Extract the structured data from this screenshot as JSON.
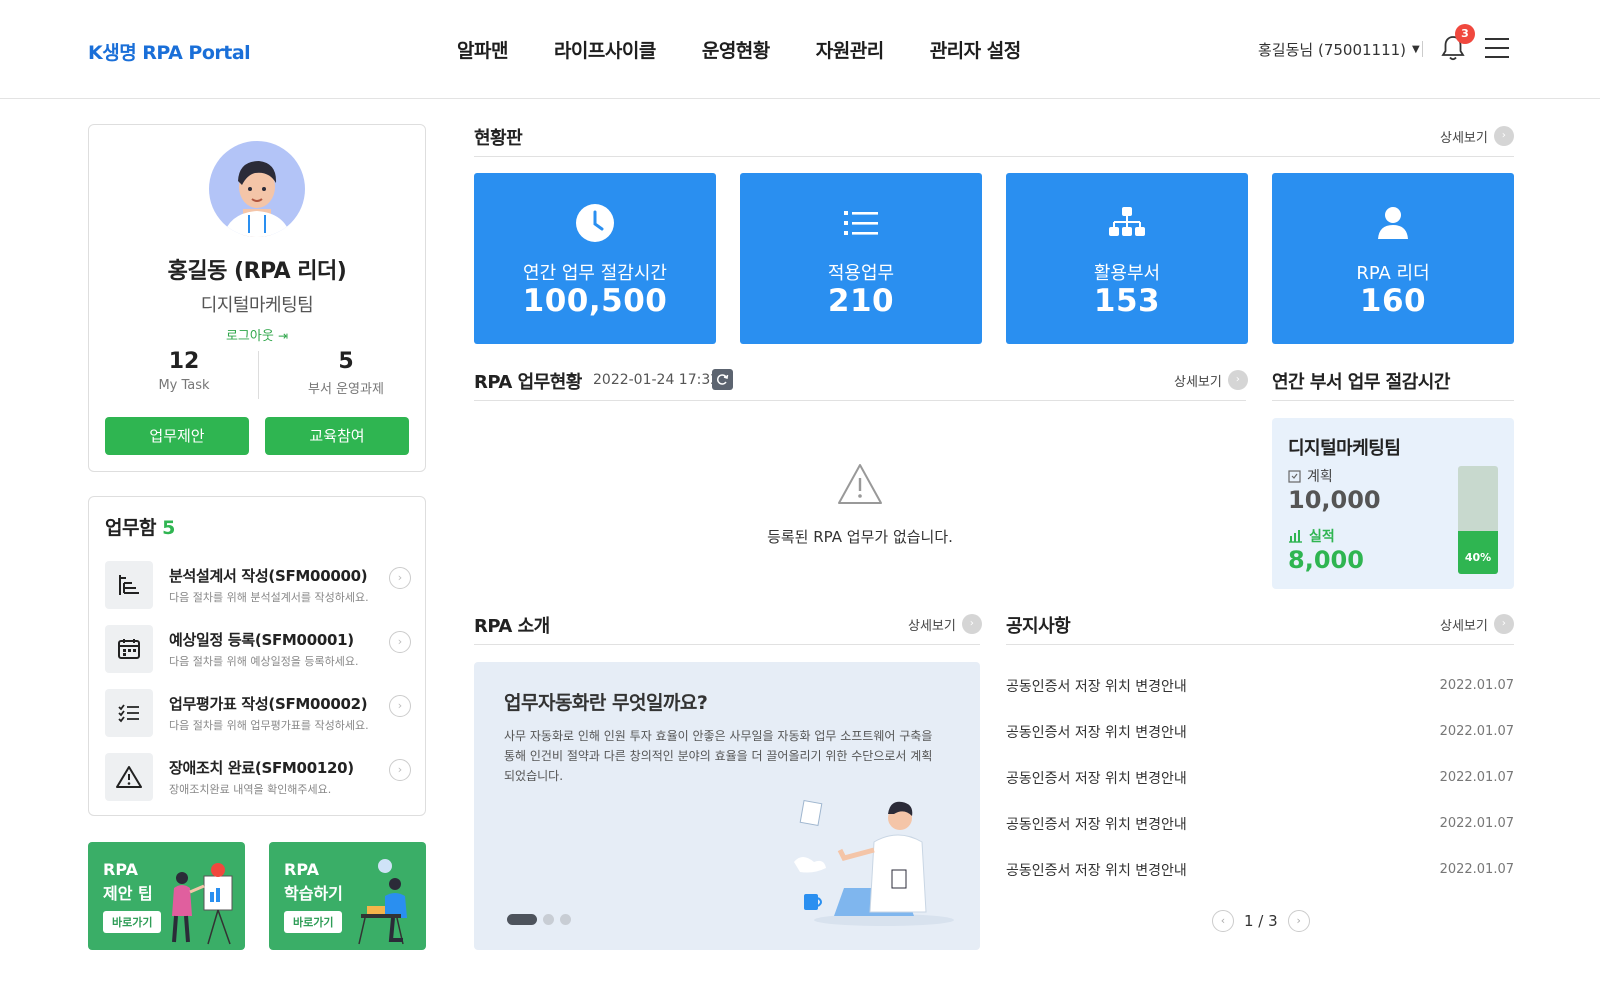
{
  "header": {
    "logo": "K생명 RPA Portal",
    "nav": [
      "알파맨",
      "라이프사이클",
      "운영현황",
      "자원관리",
      "관리자 설정"
    ],
    "user": "홍길동님 (75001111)",
    "notification_count": "3"
  },
  "profile": {
    "name": "홍길동 (RPA 리더)",
    "team": "디지털마케팅팀",
    "logout": "로그아웃",
    "stats": [
      {
        "value": "12",
        "label": "My Task"
      },
      {
        "value": "5",
        "label": "부서 운영과제"
      }
    ],
    "buttons": [
      "업무제안",
      "교육참여"
    ]
  },
  "tasks": {
    "title": "업무함",
    "count": "5",
    "items": [
      {
        "icon": "flowchart-icon",
        "name": "분석설계서 작성(SFM00000)",
        "desc": "다음 절차를 위해 분석설계서를 작성하세요."
      },
      {
        "icon": "calendar-icon",
        "name": "예상일정 등록(SFM00001)",
        "desc": "다음 절차를 위해 예상일정을 등록하세요."
      },
      {
        "icon": "checklist-icon",
        "name": "업무평가표 작성(SFM00002)",
        "desc": "다음 절차를 위해 업무평가표를 작성하세요."
      },
      {
        "icon": "warning-icon",
        "name": "장애조치 완료(SFM00120)",
        "desc": "장애조치완료 내역을 확인해주세요."
      }
    ]
  },
  "banners": [
    {
      "line1": "RPA",
      "line2": "제안 팁",
      "go": "바로가기"
    },
    {
      "line1": "RPA",
      "line2": "학습하기",
      "go": "바로가기"
    }
  ],
  "dashboard": {
    "title": "현황판",
    "more": "상세보기",
    "tiles": [
      {
        "icon": "clock-icon",
        "label": "연간 업무 절감시간",
        "value": "100,500"
      },
      {
        "icon": "list-icon",
        "label": "적용업무",
        "value": "210"
      },
      {
        "icon": "org-chart-icon",
        "label": "활용부서",
        "value": "153"
      },
      {
        "icon": "user-icon",
        "label": "RPA 리더",
        "value": "160"
      }
    ]
  },
  "rpa_status": {
    "title": "RPA 업무현황",
    "timestamp": "2022-01-24 17:32",
    "more": "상세보기",
    "empty": "등록된 RPA 업무가 없습니다."
  },
  "dept_saving": {
    "title": "연간 부서 업무 절감시간",
    "dept": "디지털마케팅팀",
    "plan_label": "계획",
    "plan_value": "10,000",
    "actual_label": "실적",
    "actual_value": "8,000",
    "percent_label": "40%",
    "percent": 0.4
  },
  "intro": {
    "title": "RPA 소개",
    "more": "상세보기",
    "heading": "업무자동화란 무엇일까요?",
    "body": "사무 자동화로 인해 인원 투자 효율이 안좋은 사무일을 자동화 업무 소프트웨어 구축을 통해 인건비 절약과 다른 창의적인 분야의 효율을 더 끌어올리기 위한 수단으로서 계획되었습니다."
  },
  "notice": {
    "title": "공지사항",
    "more": "상세보기",
    "items": [
      {
        "title": "공동인증서 저장 위치 변경안내",
        "date": "2022.01.07"
      },
      {
        "title": "공동인증서 저장 위치 변경안내",
        "date": "2022.01.07"
      },
      {
        "title": "공동인증서 저장 위치 변경안내",
        "date": "2022.01.07"
      },
      {
        "title": "공동인증서 저장 위치 변경안내",
        "date": "2022.01.07"
      },
      {
        "title": "공동인증서 저장 위치 변경안내",
        "date": "2022.01.07"
      }
    ],
    "page": "1 / 3"
  },
  "colors": {
    "brand_blue": "#1a6fd8",
    "tile_blue": "#2a8ff0",
    "green": "#2fb551",
    "badge_red": "#f0483e"
  }
}
